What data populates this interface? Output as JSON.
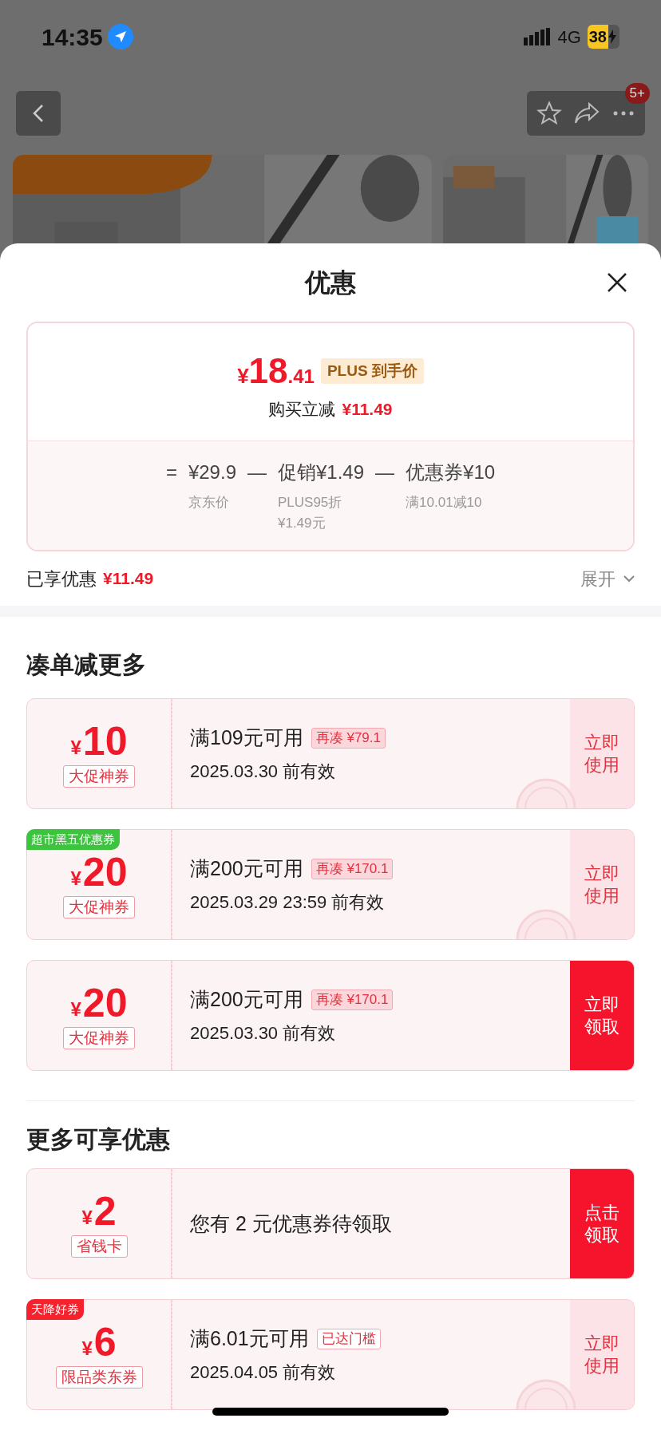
{
  "status_bar": {
    "time": "14:35",
    "network": "4G",
    "battery": "38"
  },
  "nav": {
    "badge": "5+"
  },
  "sheet": {
    "title": "优惠",
    "price": {
      "currency": "¥",
      "integer": "18",
      "decimal": ".41",
      "tag": "PLUS 到手价",
      "saving_label": "购买立减",
      "saving_value": "¥11.49"
    },
    "breakdown": [
      {
        "kind": "operator",
        "text": "="
      },
      {
        "kind": "term",
        "value": "¥29.9",
        "notes": [
          "京东价"
        ]
      },
      {
        "kind": "operator",
        "text": "—"
      },
      {
        "kind": "term",
        "value": "促销¥1.49",
        "notes": [
          "PLUS95折",
          "¥1.49元"
        ]
      },
      {
        "kind": "operator",
        "text": "—"
      },
      {
        "kind": "term",
        "value": "优惠券¥10",
        "notes": [
          "满10.01减10"
        ]
      }
    ],
    "enjoyed": {
      "label": "已享优惠",
      "value": "¥11.49",
      "expand": "展开"
    },
    "sections": [
      {
        "title": "凑单减更多",
        "coupons": [
          {
            "currency": "¥",
            "amount": "10",
            "type": "大促神券",
            "condition": "满109元可用",
            "tag": {
              "kind": "filled",
              "text": "再凑 ¥79.1"
            },
            "validity": "2025.03.30 前有效",
            "action": "立即使用",
            "primary": false,
            "claimed": true
          },
          {
            "corner": {
              "text": "超市黑五优惠券",
              "color": "#3dc43f"
            },
            "currency": "¥",
            "amount": "20",
            "type": "大促神券",
            "condition": "满200元可用",
            "tag": {
              "kind": "filled",
              "text": "再凑 ¥170.1"
            },
            "validity": "2025.03.29 23:59 前有效",
            "action": "立即使用",
            "primary": false,
            "claimed": true
          },
          {
            "currency": "¥",
            "amount": "20",
            "type": "大促神券",
            "condition": "满200元可用",
            "tag": {
              "kind": "filled",
              "text": "再凑 ¥170.1"
            },
            "validity": "2025.03.30 前有效",
            "action": "立即领取",
            "primary": true,
            "claimed": false
          }
        ]
      },
      {
        "title": "更多可享优惠",
        "coupons": [
          {
            "currency": "¥",
            "amount": "2",
            "type": "省钱卡",
            "message": "您有 2 元优惠券待领取",
            "action": "点击领取",
            "primary": true,
            "claimed": false
          },
          {
            "corner": {
              "text": "天降好券",
              "color": "#f5222d"
            },
            "currency": "¥",
            "amount": "6",
            "type": "限品类东券",
            "condition": "满6.01元可用",
            "tag": {
              "kind": "outline",
              "text": "已达门槛"
            },
            "validity": "2025.04.05 前有效",
            "action": "立即使用",
            "primary": false,
            "claimed": true
          }
        ]
      }
    ]
  }
}
